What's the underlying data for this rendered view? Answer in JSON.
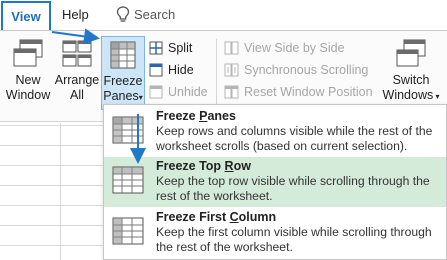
{
  "tabs": {
    "view": "View",
    "help": "Help",
    "search": "Search"
  },
  "ribbon": {
    "new_window": [
      "New",
      "Window"
    ],
    "arrange_all": [
      "Arrange",
      "All"
    ],
    "freeze_panes": [
      "Freeze",
      "Panes"
    ],
    "split": "Split",
    "hide": "Hide",
    "unhide": "Unhide",
    "view_side_by_side": "View Side by Side",
    "sync_scrolling": "Synchronous Scrolling",
    "reset_window_position": "Reset Window Position",
    "switch_windows": [
      "Switch",
      "Windows"
    ]
  },
  "menu": {
    "items": [
      {
        "title_pre": "Freeze ",
        "title_u": "P",
        "title_post": "anes",
        "desc": "Keep rows and columns visible while the rest of the worksheet scrolls (based on current selection)."
      },
      {
        "title_pre": "Freeze Top ",
        "title_u": "R",
        "title_post": "ow",
        "desc": "Keep the top row visible while scrolling through the rest of the worksheet."
      },
      {
        "title_pre": "Freeze First ",
        "title_u": "C",
        "title_post": "olumn",
        "desc": "Keep the first column visible while scrolling through the rest of the worksheet."
      }
    ],
    "highlighted_index": 1
  },
  "colors": {
    "accent_blue": "#1f78c8",
    "highlight_green": "#d5ebd9",
    "active_button": "#cde6f7"
  }
}
